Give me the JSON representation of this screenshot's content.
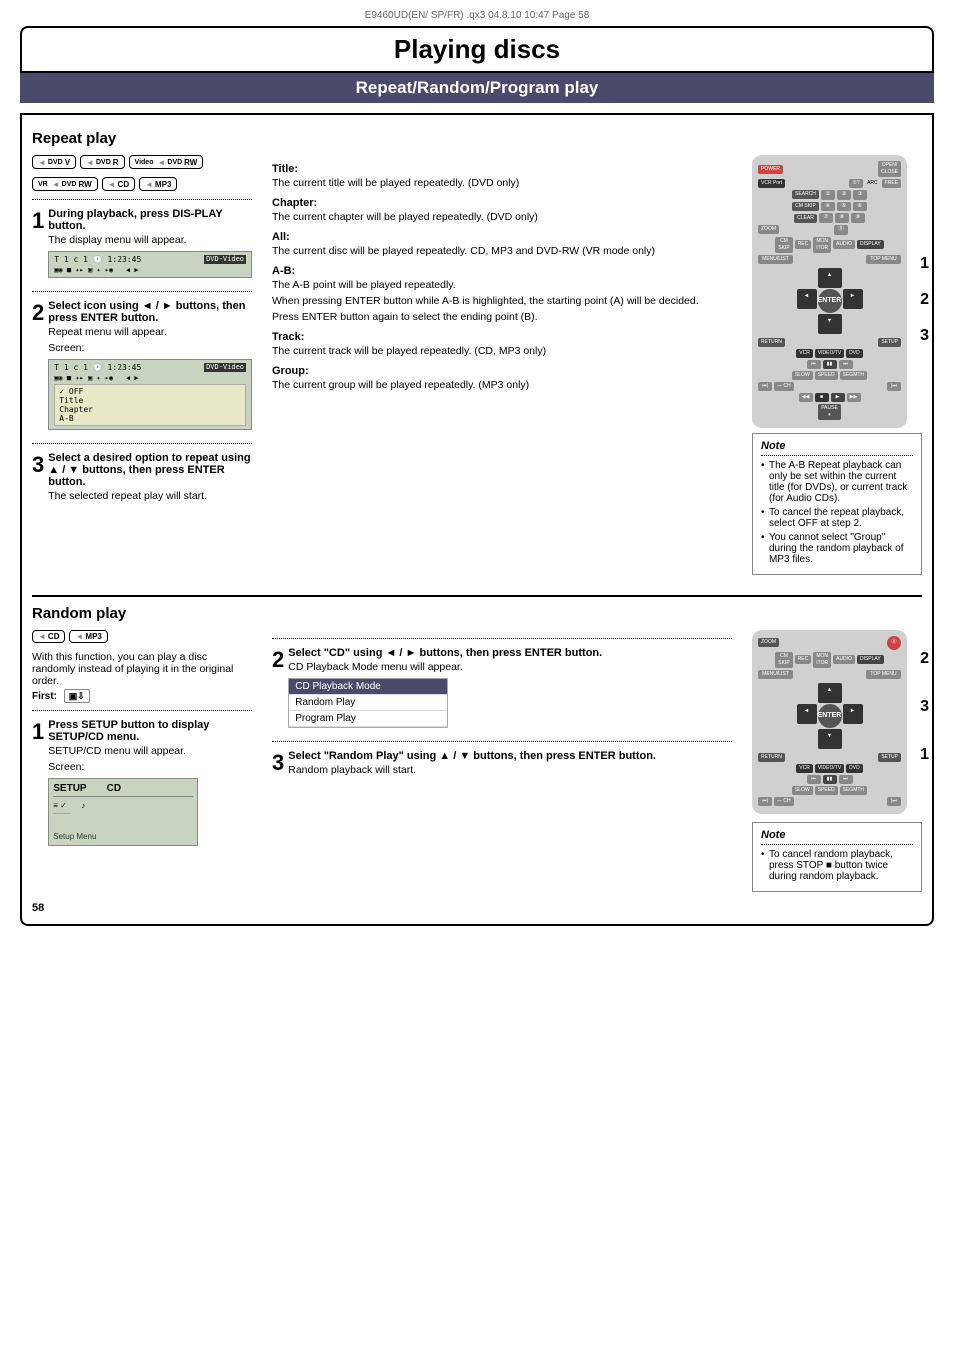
{
  "page": {
    "header_text": "E9460UD(EN/ SP/FR)  .qx3  04.8.10  10:47  Page 58",
    "main_title": "Playing discs",
    "section_title": "Repeat/Random/Program play",
    "page_number": "58"
  },
  "repeat_play": {
    "title": "Repeat play",
    "disc_logos": [
      "DVD-V",
      "DVD-R",
      "Video DVD-RW",
      "VR DVD-RW",
      "CD",
      "MP3"
    ],
    "step1": {
      "number": "1",
      "bold_text": "During playback, press DIS-PLAY button.",
      "sub_text": "The display menu will appear."
    },
    "step2": {
      "number": "2",
      "bold_text": "Select  icon using ◄ / ► buttons, then press ENTER button.",
      "sub_text": "Repeat menu will appear.",
      "screen_label": "Screen:"
    },
    "step3": {
      "number": "3",
      "bold_text": "Select a desired option to repeat using ▲ / ▼ buttons, then press ENTER button.",
      "sub_text": "The selected repeat play will start."
    },
    "options": {
      "title_opt": {
        "label": "Title:",
        "text": "The current title will be played repeatedly. (DVD only)"
      },
      "chapter_opt": {
        "label": "Chapter:",
        "text": "The current chapter will be played repeatedly. (DVD only)"
      },
      "all_opt": {
        "label": "All:",
        "text": "The current disc will be played repeatedly. CD, MP3 and DVD-RW (VR mode only)"
      },
      "ab_opt": {
        "label": "A-B:",
        "text1": "The A-B point will be played repeatedly.",
        "text2": "When pressing ENTER button while A-B is highlighted, the starting point (A) will be decided.",
        "text3": "Press ENTER button again to select the ending point (B)."
      },
      "track_opt": {
        "label": "Track:",
        "text": "The current track will be played repeatedly. (CD, MP3 only)"
      },
      "group_opt": {
        "label": "Group:",
        "text": "The current group will be played repeatedly. (MP3 only)"
      }
    },
    "screen_menu_items": [
      "✓ OFF",
      "Title",
      "Chapter",
      "A-B"
    ],
    "note": {
      "title": "Note",
      "items": [
        "The A-B Repeat playback can only be set within the current title (for DVDs), or current track (for Audio CDs).",
        "To cancel the repeat playback, select OFF at step 2.",
        "You cannot select \"Group\" during the random playback of MP3 files."
      ]
    }
  },
  "random_play": {
    "title": "Random play",
    "disc_logos": [
      "CD",
      "MP3"
    ],
    "intro_text": "With this function, you can play a disc randomly instead of playing it in the original order.",
    "first_label": "First:",
    "step1": {
      "number": "1",
      "bold_text": "Press SETUP button to display SETUP/CD menu.",
      "sub_text": "SETUP/CD menu will appear.",
      "screen_label": "Screen:"
    },
    "step2": {
      "number": "2",
      "bold_text": "Select \"CD\" using ◄ / ► buttons, then press ENTER button.",
      "sub_text": "CD Playback Mode menu will appear."
    },
    "step3": {
      "number": "3",
      "bold_text": "Select \"Random Play\" using ▲ / ▼ buttons, then press ENTER button.",
      "sub_text": "Random playback will start."
    },
    "cd_menu_items": [
      "CD Playback Mode",
      "Random Play",
      "Program Play"
    ],
    "setup_screen_items_left": [
      "SETUP",
      "≡ ✓"
    ],
    "setup_screen_items_right": [
      "CD",
      "♪"
    ],
    "setup_menu_label": "Setup Menu",
    "note": {
      "title": "Note",
      "items": [
        "To cancel random playback, press STOP ■ button twice during random playback."
      ]
    }
  },
  "remote_step_labels": {
    "repeat": [
      "1",
      "2",
      "3"
    ],
    "random": [
      "2",
      "3",
      "1"
    ]
  }
}
